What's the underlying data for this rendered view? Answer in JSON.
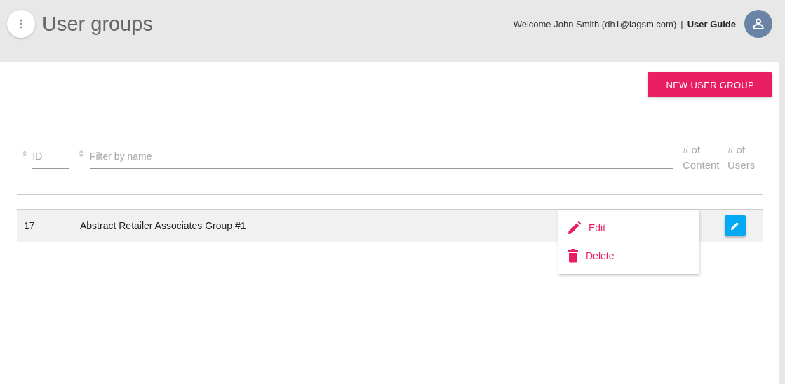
{
  "header": {
    "title": "User groups",
    "welcome": "Welcome John Smith (dh1@lagsm.com)",
    "separator": "|",
    "guide_link": "User Guide"
  },
  "new_button": "NEW USER GROUP",
  "table": {
    "columns": [
      {
        "kind": "id",
        "placeholder": "ID"
      },
      {
        "kind": "name",
        "placeholder": "Filter by name"
      },
      {
        "kind": "static",
        "label": "# of Content"
      },
      {
        "kind": "static",
        "label": "# of Users"
      }
    ],
    "rows": [
      {
        "id": "17",
        "name": "Abstract Retailer Associates Group #1",
        "selected": true
      }
    ]
  },
  "row_menu": {
    "items": [
      {
        "kind": "edit",
        "label": "Edit"
      },
      {
        "kind": "delete",
        "label": "Delete"
      }
    ]
  }
}
